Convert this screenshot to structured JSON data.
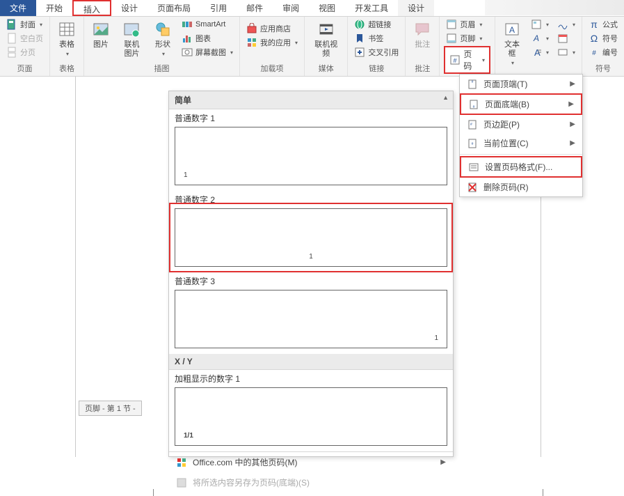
{
  "tabs": {
    "file": "文件",
    "home": "开始",
    "insert": "插入",
    "design": "设计",
    "layout": "页面布局",
    "references": "引用",
    "mailings": "邮件",
    "review": "审阅",
    "view": "视图",
    "developer": "开发工具",
    "design2": "设计"
  },
  "groups": {
    "pages": {
      "label": "页面",
      "cover": "封面",
      "blank": "空白页",
      "break": "分页"
    },
    "tables": {
      "label": "表格",
      "btn": "表格"
    },
    "illustrations": {
      "label": "插图",
      "pic": "图片",
      "online_pic": "联机图片",
      "shapes": "形状",
      "smartart": "SmartArt",
      "chart": "图表",
      "screenshot": "屏幕截图"
    },
    "addins": {
      "label": "加载项",
      "store": "应用商店",
      "myaddins": "我的应用"
    },
    "media": {
      "label": "媒体",
      "video": "联机视频"
    },
    "links": {
      "label": "链接",
      "hyperlink": "超链接",
      "bookmark": "书签",
      "crossref": "交叉引用"
    },
    "comments": {
      "label": "批注",
      "btn": "批注"
    },
    "headerfooter": {
      "header": "页眉",
      "footer": "页脚",
      "pagenum": "页码"
    },
    "text": {
      "label": "文本框",
      "btn": "文本框"
    },
    "symbols": {
      "label": "符号",
      "equation": "公式",
      "symbol": "符号",
      "number": "编号"
    }
  },
  "footer_tag": "页脚 - 第 1 节 -",
  "gallery": {
    "head": "简单",
    "opt1": "普通数字 1",
    "opt2": "普通数字 2",
    "opt3": "普通数字 3",
    "head2": "X / Y",
    "opt4": "加粗显示的数字 1",
    "pv4_text": "1/1",
    "office_more": "Office.com 中的其他页码(M)",
    "save_sel": "将所选内容另存为页码(底端)(S)"
  },
  "submenu": {
    "top": "页面顶端(T)",
    "bottom": "页面底端(B)",
    "margins": "页边距(P)",
    "current": "当前位置(C)",
    "format": "设置页码格式(F)...",
    "remove": "删除页码(R)"
  },
  "glyphs": {
    "arrow_right": "▶",
    "arrow_up": "▲",
    "dd": "▾"
  }
}
